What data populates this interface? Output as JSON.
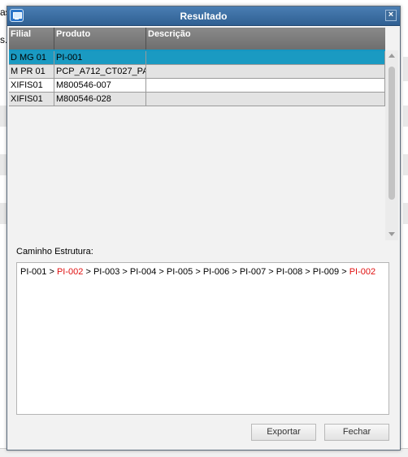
{
  "background": {
    "fragments": [
      "as",
      "s."
    ]
  },
  "dialog": {
    "title": "Resultado",
    "app_icon": "window-icon",
    "close_glyph": "×"
  },
  "grid": {
    "columns": [
      "Filial",
      "Produto",
      "Descrição"
    ],
    "rows": [
      {
        "filial": "D MG 01",
        "produto": "PI-001",
        "descricao": ""
      },
      {
        "filial": "M PR 01",
        "produto": "PCP_A712_CT027_PA",
        "descricao": ""
      },
      {
        "filial": "XIFIS01",
        "produto": "M800546-007",
        "descricao": ""
      },
      {
        "filial": "XIFIS01",
        "produto": "M800546-028",
        "descricao": ""
      }
    ],
    "selected_row": 0
  },
  "path": {
    "label": "Caminho Estrutura:",
    "segments": [
      {
        "text": "PI-001",
        "highlight": false
      },
      {
        "text": "PI-002",
        "highlight": true
      },
      {
        "text": "PI-003",
        "highlight": false
      },
      {
        "text": "PI-004",
        "highlight": false
      },
      {
        "text": "PI-005",
        "highlight": false
      },
      {
        "text": "PI-006",
        "highlight": false
      },
      {
        "text": "PI-007",
        "highlight": false
      },
      {
        "text": "PI-008",
        "highlight": false
      },
      {
        "text": "PI-009",
        "highlight": false
      },
      {
        "text": "PI-002",
        "highlight": true
      }
    ],
    "separator": " > "
  },
  "buttons": {
    "export_label": "Exportar",
    "close_label": "Fechar"
  },
  "colors": {
    "title_bar": "#3a6ea5",
    "selected_row": "#1a9ac2",
    "header": "#7a7a7a",
    "highlight_text": "#e01010"
  }
}
